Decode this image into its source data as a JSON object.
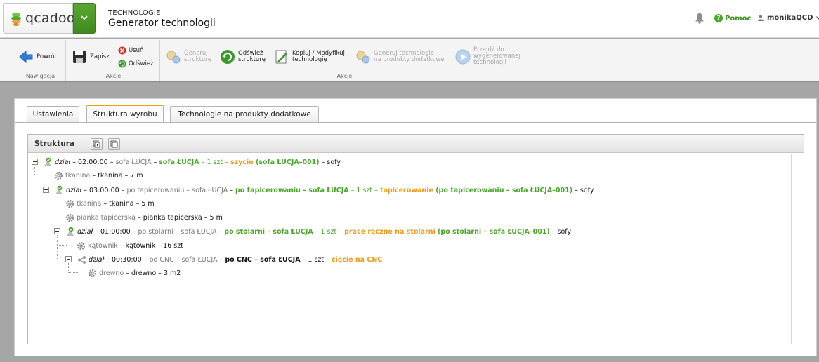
{
  "header": {
    "logo_text": "qcadoo",
    "section": "TECHNOLOGIE",
    "title": "Generator technologii",
    "help_label": "Pomoc",
    "user_name": "monikaQCD"
  },
  "ribbon": {
    "groups": {
      "nav_label": "Nawigacja",
      "actions1_label": "Akcje",
      "actions2_label": "Akcje"
    },
    "buttons": {
      "back": "Powrót",
      "save": "Zapisz",
      "delete": "Usuń",
      "refresh": "Odśwież",
      "generate_line1": "Generuj",
      "generate_line2": "strukturę",
      "refresh_struct_line1": "Odśwież",
      "refresh_struct_line2": "strukturę",
      "copy_line1": "Kopiuj / Modyfikuj",
      "copy_line2": "technologię",
      "gen_tech_line1": "Generuj technologie",
      "gen_tech_line2": "na produkty dodatkowe",
      "goto_line1": "Przejdź do",
      "goto_line2": "wygenerowanej",
      "goto_line3": "technologii"
    }
  },
  "tabs": [
    "Ustawienia",
    "Struktura wyrobu",
    "Technologie na produkty dodatkowe"
  ],
  "structure": {
    "title": "Struktura",
    "nodes": [
      {
        "parts": [
          "dział",
          " – 02:00:00 – ",
          "sofa ŁUCJA",
          " – ",
          "sofa ŁUCJA",
          " – 1 szt – ",
          "szycie",
          " (sofa ŁUCJA–001)",
          " – sofy"
        ]
      },
      {
        "parts": [
          "tkanina",
          " – tkanina – 7 m"
        ]
      },
      {
        "parts": [
          "dział",
          " – 03:00:00 – ",
          "po tapicerowaniu – sofa ŁUCJA",
          " – ",
          "po tapicerowaniu – sofa ŁUCJA",
          " – 1 szt – ",
          "tapicerowanie",
          " (po tapicerowaniu – sofa ŁUCJA–001)",
          " – sofy"
        ]
      },
      {
        "parts": [
          "tkanina",
          " – tkanina – 5 m"
        ]
      },
      {
        "parts": [
          "pianka tapicerska",
          " – pianka tapicerska – 5 m"
        ]
      },
      {
        "parts": [
          "dział",
          " – 01:00:00 – ",
          "po stolarni – sofa ŁUCJA",
          " – ",
          "po stolarni – sofa ŁUCJA",
          " – 1 szt – ",
          "prace ręczne na stolarni",
          " (po stolarni – sofa ŁUCJA–001)",
          " – sofy"
        ]
      },
      {
        "parts": [
          "kątownik",
          " – kątownik – 16 szt"
        ]
      },
      {
        "parts": [
          "dział",
          " – 00:30:00 – ",
          "po CNC – sofa ŁUCJA",
          " – ",
          "po CNC – sofa ŁUCJA",
          " – 1 szt – ",
          "cięcie na CNC"
        ]
      },
      {
        "parts": [
          "drewno",
          " – drewno – 3 m2"
        ]
      }
    ]
  },
  "colors": {
    "accent_green": "#49a62a",
    "accent_orange": "#f39a1d",
    "tab_active": "#f0a000"
  }
}
